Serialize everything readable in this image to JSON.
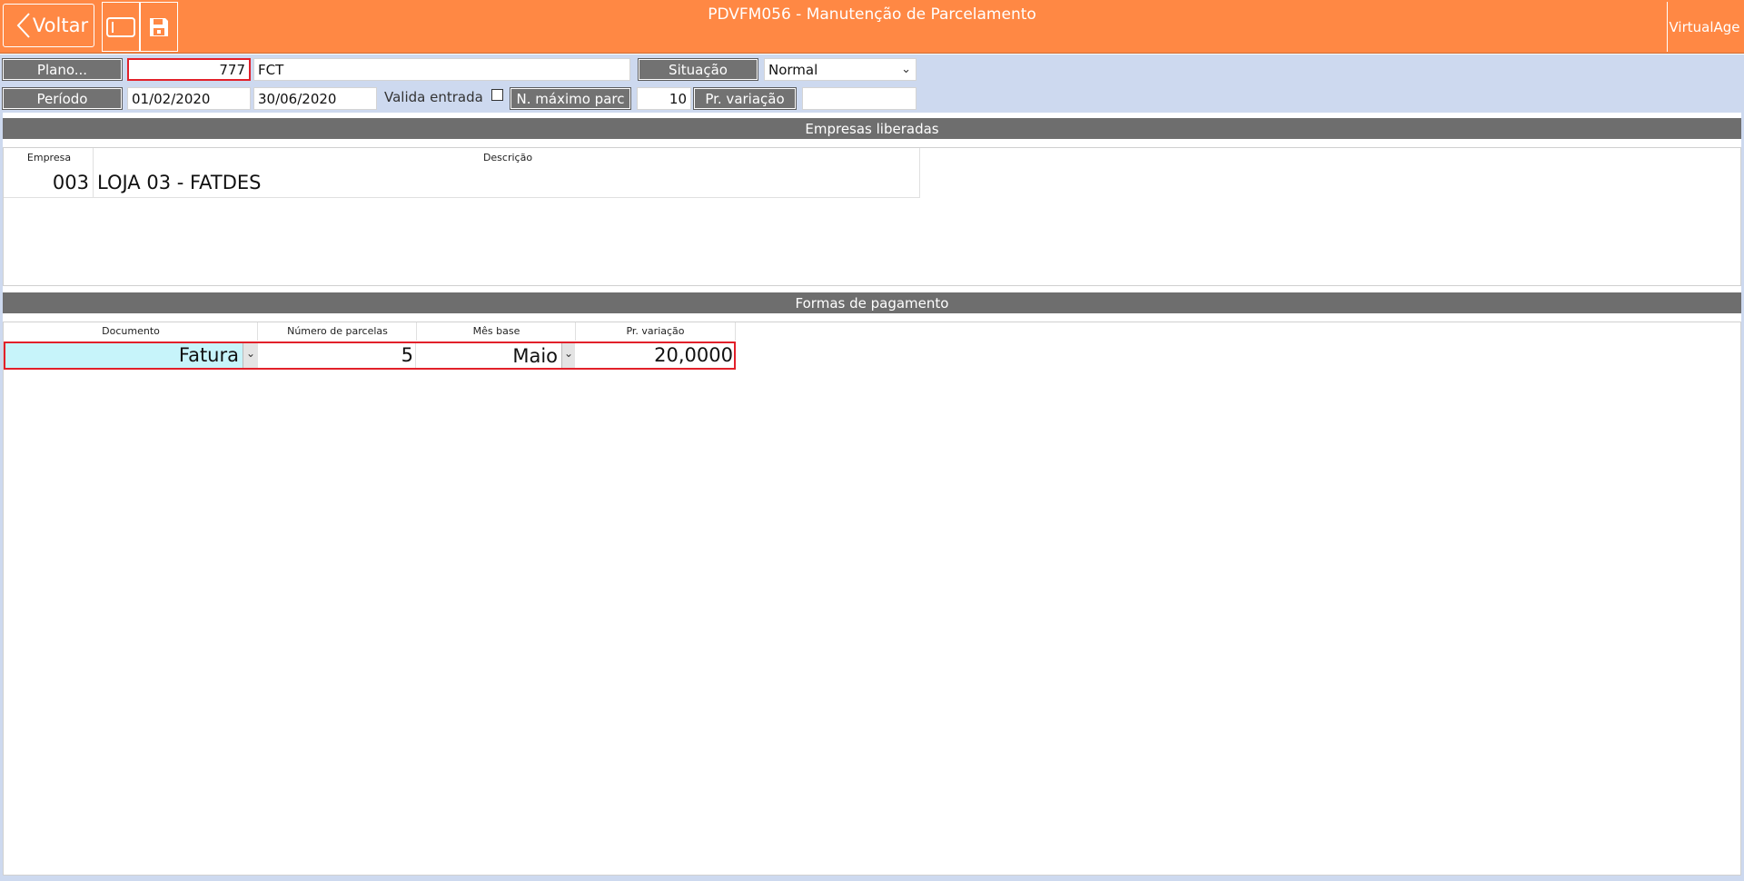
{
  "header": {
    "back_label": "Voltar",
    "title": "PDVFM056 - Manutenção de Parcelamento",
    "brand": "VirtualAge",
    "icons": [
      "chevron-left-icon",
      "window-icon",
      "save-icon"
    ],
    "accent_color": "#ff8844"
  },
  "form": {
    "plano_label": "Plano...",
    "plano_code": "777",
    "plano_desc": "FCT",
    "situacao_label": "Situação",
    "situacao_value": "Normal",
    "periodo_label": "Período",
    "periodo_inicio": "01/02/2020",
    "periodo_fim": "30/06/2020",
    "valida_entrada_label": "Valida entrada",
    "valida_entrada_checked": false,
    "max_parc_label": "N. máximo parc",
    "max_parc_value": "10",
    "pr_variacao_label": "Pr. variação",
    "pr_variacao_value": ""
  },
  "empresas": {
    "section_title": "Empresas liberadas",
    "columns": [
      "Empresa",
      "Descrição"
    ],
    "rows": [
      {
        "empresa": "003",
        "descricao": "LOJA 03 - FATDES"
      }
    ]
  },
  "formas": {
    "section_title": "Formas de pagamento",
    "columns": [
      "Documento",
      "Número de parcelas",
      "Mês base",
      "Pr. variação"
    ],
    "rows": [
      {
        "documento": "Fatura",
        "parcelas": "5",
        "mes_base": "Maio",
        "pr_variacao": "20,0000"
      }
    ]
  }
}
